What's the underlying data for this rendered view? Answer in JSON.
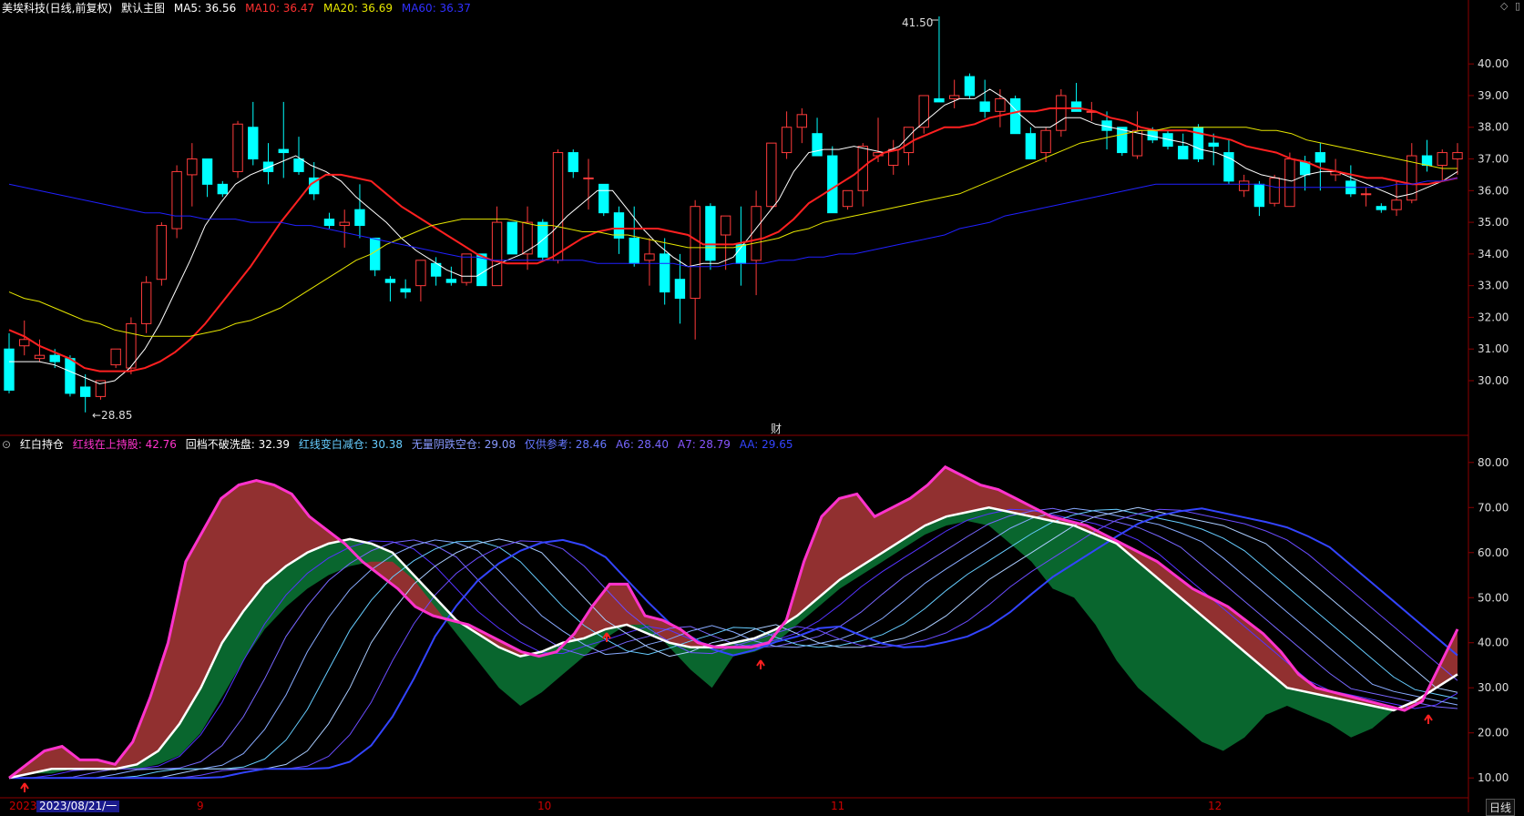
{
  "header": {
    "stock": "美埃科技(日线,前复权)",
    "main_chart": "默认主图",
    "ma5": "MA5: 36.56",
    "ma10": "MA10: 36.47",
    "ma20": "MA20: 36.69",
    "ma60": "MA60: 36.37"
  },
  "indicator_header": {
    "name": "红白持仓",
    "v1": "红线在上持股: 42.76",
    "v2": "回档不破洗盘: 32.39",
    "v3": "红线变白减仓: 30.38",
    "v4": "无量阴跌空仓: 29.08",
    "v5": "仅供参考: 28.46",
    "v6": "A6: 28.40",
    "v7": "A7: 28.79",
    "v8": "AA: 29.65"
  },
  "price_axis": [
    "40.00",
    "39.00",
    "38.00",
    "37.00",
    "36.00",
    "35.00",
    "34.00",
    "33.00",
    "32.00",
    "31.00",
    "30.00"
  ],
  "ind_axis": [
    "80.00",
    "70.00",
    "60.00",
    "50.00",
    "40.00",
    "30.00",
    "20.00",
    "10.00"
  ],
  "annotations": {
    "high": "41.50",
    "low": "←28.85",
    "cai": "财"
  },
  "xaxis": {
    "year": "2023",
    "cursor_date": "2023/08/21/一",
    "months": [
      "9",
      "10",
      "11",
      "12"
    ],
    "period": "日线"
  },
  "colors": {
    "up": "#ff3b3b",
    "down": "#00ffff",
    "ma5": "#ffffff",
    "ma10": "#ff2020",
    "ma20": "#e6e600",
    "ma60": "#2020ff",
    "magenta": "#ff33cc",
    "red_fill": "#993333",
    "green_fill": "#0a6b30"
  },
  "chart_data": {
    "type": "candlestick",
    "ohlc": [
      [
        31.0,
        31.5,
        29.6,
        29.7
      ],
      [
        31.1,
        31.9,
        30.8,
        31.3
      ],
      [
        30.7,
        31.3,
        30.6,
        30.8
      ],
      [
        30.8,
        31.0,
        30.4,
        30.6
      ],
      [
        30.7,
        30.8,
        29.5,
        29.6
      ],
      [
        29.8,
        30.2,
        29.0,
        29.5
      ],
      [
        29.5,
        30.0,
        29.4,
        30.0
      ],
      [
        30.5,
        31.0,
        30.4,
        31.0
      ],
      [
        30.4,
        32.0,
        30.2,
        31.8
      ],
      [
        31.8,
        33.3,
        31.5,
        33.1
      ],
      [
        33.2,
        35.0,
        33.0,
        34.9
      ],
      [
        34.8,
        36.8,
        34.5,
        36.6
      ],
      [
        36.5,
        37.5,
        35.5,
        37.0
      ],
      [
        37.0,
        36.9,
        35.8,
        36.2
      ],
      [
        36.2,
        36.3,
        35.8,
        35.9
      ],
      [
        36.6,
        38.2,
        36.4,
        38.1
      ],
      [
        38.0,
        38.8,
        36.8,
        37.0
      ],
      [
        36.9,
        37.5,
        36.2,
        36.6
      ],
      [
        37.3,
        38.8,
        36.4,
        37.2
      ],
      [
        37.0,
        37.7,
        36.5,
        36.6
      ],
      [
        36.4,
        36.9,
        35.7,
        35.9
      ],
      [
        35.1,
        35.3,
        34.8,
        34.9
      ],
      [
        34.9,
        35.4,
        34.2,
        35.0
      ],
      [
        35.4,
        36.2,
        34.5,
        34.9
      ],
      [
        34.5,
        34.5,
        33.3,
        33.5
      ],
      [
        33.2,
        33.3,
        32.5,
        33.1
      ],
      [
        32.9,
        33.2,
        32.6,
        32.8
      ],
      [
        33.0,
        33.7,
        32.5,
        33.8
      ],
      [
        33.7,
        33.9,
        33.0,
        33.3
      ],
      [
        33.2,
        33.6,
        33.0,
        33.1
      ],
      [
        33.1,
        34.0,
        33.0,
        34.0
      ],
      [
        34.0,
        34.0,
        33.0,
        33.0
      ],
      [
        33.0,
        35.5,
        33.0,
        35.0
      ],
      [
        35.0,
        35.0,
        34.0,
        34.0
      ],
      [
        34.0,
        35.5,
        33.5,
        35.0
      ],
      [
        35.0,
        35.1,
        33.8,
        33.9
      ],
      [
        33.8,
        37.3,
        33.7,
        37.2
      ],
      [
        37.2,
        37.3,
        36.4,
        36.6
      ],
      [
        36.4,
        37.0,
        35.4,
        36.4
      ],
      [
        36.2,
        36.2,
        35.2,
        35.3
      ],
      [
        35.3,
        35.5,
        34.0,
        34.5
      ],
      [
        34.5,
        35.5,
        33.6,
        33.7
      ],
      [
        33.8,
        34.5,
        33.0,
        34.0
      ],
      [
        34.0,
        34.5,
        32.4,
        32.8
      ],
      [
        33.2,
        34.0,
        31.8,
        32.6
      ],
      [
        32.6,
        35.7,
        31.3,
        35.5
      ],
      [
        35.5,
        35.6,
        33.5,
        33.8
      ],
      [
        34.6,
        35.2,
        33.5,
        35.2
      ],
      [
        34.3,
        35.5,
        33.0,
        33.7
      ],
      [
        33.8,
        36.0,
        32.7,
        35.5
      ],
      [
        35.5,
        37.5,
        35.4,
        37.5
      ],
      [
        37.2,
        38.5,
        37.0,
        38.0
      ],
      [
        38.0,
        38.6,
        37.5,
        38.4
      ],
      [
        37.8,
        38.3,
        37.2,
        37.1
      ],
      [
        37.1,
        37.4,
        35.8,
        35.3
      ],
      [
        35.5,
        36.0,
        35.4,
        36.0
      ],
      [
        36.0,
        37.5,
        35.5,
        37.4
      ],
      [
        37.1,
        38.3,
        36.9,
        37.2
      ],
      [
        36.8,
        37.6,
        36.5,
        37.3
      ],
      [
        37.2,
        38.0,
        36.8,
        38.0
      ],
      [
        38.0,
        39.0,
        37.8,
        39.0
      ],
      [
        38.9,
        41.5,
        38.8,
        38.8
      ],
      [
        38.9,
        39.5,
        38.6,
        39.0
      ],
      [
        39.6,
        39.7,
        38.9,
        39.0
      ],
      [
        38.8,
        39.5,
        38.3,
        38.5
      ],
      [
        38.5,
        39.2,
        38.0,
        38.9
      ],
      [
        38.9,
        39.0,
        37.8,
        37.8
      ],
      [
        37.8,
        38.0,
        37.0,
        37.0
      ],
      [
        37.2,
        38.0,
        36.9,
        37.9
      ],
      [
        37.9,
        39.2,
        37.7,
        39.0
      ],
      [
        38.8,
        39.4,
        38.5,
        38.5
      ],
      [
        38.5,
        38.8,
        38.2,
        38.5
      ],
      [
        38.2,
        38.5,
        37.3,
        37.9
      ],
      [
        38.0,
        38.0,
        37.1,
        37.2
      ],
      [
        37.1,
        38.5,
        37.0,
        37.9
      ],
      [
        37.9,
        38.0,
        37.5,
        37.6
      ],
      [
        37.8,
        37.9,
        37.3,
        37.4
      ],
      [
        37.4,
        37.8,
        37.0,
        37.0
      ],
      [
        38.0,
        38.1,
        36.9,
        37.0
      ],
      [
        37.5,
        37.8,
        36.8,
        37.4
      ],
      [
        37.2,
        37.6,
        36.2,
        36.3
      ],
      [
        36.0,
        36.5,
        35.8,
        36.3
      ],
      [
        36.2,
        36.3,
        35.2,
        35.5
      ],
      [
        35.6,
        36.5,
        35.5,
        36.4
      ],
      [
        35.5,
        37.2,
        35.5,
        37.0
      ],
      [
        36.9,
        37.1,
        36.0,
        36.5
      ],
      [
        37.2,
        37.5,
        36.0,
        36.9
      ],
      [
        36.5,
        37.0,
        36.3,
        36.6
      ],
      [
        36.3,
        36.8,
        35.8,
        35.9
      ],
      [
        35.9,
        36.1,
        35.5,
        35.9
      ],
      [
        35.5,
        35.6,
        35.3,
        35.4
      ],
      [
        35.4,
        36.3,
        35.2,
        35.7
      ],
      [
        35.7,
        37.5,
        35.6,
        37.1
      ],
      [
        37.1,
        37.6,
        36.6,
        36.8
      ],
      [
        36.8,
        37.3,
        36.3,
        37.2
      ],
      [
        37.0,
        37.5,
        36.5,
        37.2
      ]
    ],
    "series": [
      {
        "name": "MA5",
        "values": [
          30.6,
          30.6,
          30.6,
          30.5,
          30.3,
          30.1,
          29.9,
          30.0,
          30.4,
          31.0,
          31.8,
          32.8,
          33.8,
          34.9,
          35.6,
          36.2,
          36.5,
          36.7,
          36.9,
          37.1,
          36.8,
          36.6,
          36.3,
          35.8,
          35.4,
          35.0,
          34.5,
          34.1,
          33.8,
          33.5,
          33.3,
          33.3,
          33.6,
          33.8,
          34.0,
          34.3,
          34.7,
          35.2,
          35.6,
          36.0,
          36.0,
          35.4,
          34.8,
          34.3,
          33.9,
          33.6,
          33.7,
          33.7,
          33.9,
          34.5,
          35.1,
          35.7,
          36.6,
          37.2,
          37.3,
          37.3,
          37.4,
          37.3,
          37.2,
          37.4,
          37.9,
          38.3,
          38.7,
          38.9,
          38.9,
          39.2,
          38.9,
          38.4,
          38.0,
          38.0,
          38.3,
          38.3,
          38.1,
          38.0,
          37.9,
          37.8,
          37.7,
          37.6,
          37.5,
          37.3,
          37.2,
          37.0,
          36.7,
          36.5,
          36.4,
          36.3,
          36.5,
          36.6,
          36.6,
          36.4,
          36.2,
          36.0,
          35.8,
          35.9,
          36.1,
          36.3,
          36.6
        ]
      },
      {
        "name": "MA10",
        "values": [
          31.6,
          31.4,
          31.1,
          30.9,
          30.7,
          30.4,
          30.3,
          30.3,
          30.3,
          30.4,
          30.6,
          30.9,
          31.3,
          31.8,
          32.4,
          33.0,
          33.6,
          34.3,
          35.0,
          35.6,
          36.2,
          36.5,
          36.5,
          36.4,
          36.3,
          35.9,
          35.5,
          35.2,
          34.9,
          34.6,
          34.3,
          34.0,
          33.8,
          33.7,
          33.7,
          33.7,
          33.9,
          34.2,
          34.5,
          34.7,
          34.8,
          34.8,
          34.8,
          34.8,
          34.7,
          34.6,
          34.3,
          34.3,
          34.3,
          34.4,
          34.5,
          34.7,
          35.1,
          35.6,
          35.9,
          36.2,
          36.5,
          36.9,
          37.2,
          37.3,
          37.6,
          37.8,
          38.0,
          38.0,
          38.1,
          38.3,
          38.4,
          38.5,
          38.5,
          38.6,
          38.6,
          38.6,
          38.5,
          38.3,
          38.2,
          38.0,
          37.9,
          37.9,
          37.9,
          37.8,
          37.7,
          37.6,
          37.4,
          37.3,
          37.2,
          37.0,
          36.9,
          36.7,
          36.6,
          36.5,
          36.4,
          36.4,
          36.3,
          36.2,
          36.2,
          36.3,
          36.4
        ]
      },
      {
        "name": "MA20",
        "values": [
          32.8,
          32.6,
          32.5,
          32.3,
          32.1,
          31.9,
          31.8,
          31.6,
          31.5,
          31.4,
          31.4,
          31.4,
          31.4,
          31.5,
          31.6,
          31.8,
          31.9,
          32.1,
          32.3,
          32.6,
          32.9,
          33.2,
          33.5,
          33.8,
          34.0,
          34.3,
          34.5,
          34.7,
          34.9,
          35.0,
          35.1,
          35.1,
          35.1,
          35.1,
          35.0,
          34.9,
          34.9,
          34.8,
          34.7,
          34.7,
          34.6,
          34.6,
          34.5,
          34.4,
          34.3,
          34.2,
          34.2,
          34.2,
          34.2,
          34.3,
          34.4,
          34.5,
          34.7,
          34.8,
          35.0,
          35.1,
          35.2,
          35.3,
          35.4,
          35.5,
          35.6,
          35.7,
          35.8,
          35.9,
          36.1,
          36.3,
          36.5,
          36.7,
          36.9,
          37.1,
          37.3,
          37.5,
          37.6,
          37.7,
          37.8,
          37.9,
          37.9,
          38.0,
          38.0,
          38.0,
          38.0,
          38.0,
          38.0,
          37.9,
          37.9,
          37.8,
          37.6,
          37.5,
          37.4,
          37.3,
          37.2,
          37.1,
          37.0,
          36.9,
          36.8,
          36.7,
          36.7
        ]
      },
      {
        "name": "MA60",
        "values": [
          36.2,
          36.1,
          36.0,
          35.9,
          35.8,
          35.7,
          35.6,
          35.5,
          35.4,
          35.3,
          35.3,
          35.2,
          35.2,
          35.1,
          35.1,
          35.1,
          35.0,
          35.0,
          35.0,
          34.9,
          34.9,
          34.8,
          34.7,
          34.6,
          34.5,
          34.4,
          34.3,
          34.2,
          34.1,
          34.0,
          33.9,
          33.9,
          33.8,
          33.8,
          33.8,
          33.8,
          33.8,
          33.8,
          33.8,
          33.7,
          33.7,
          33.7,
          33.7,
          33.7,
          33.7,
          33.6,
          33.6,
          33.6,
          33.7,
          33.7,
          33.7,
          33.8,
          33.8,
          33.9,
          33.9,
          34.0,
          34.0,
          34.1,
          34.2,
          34.3,
          34.4,
          34.5,
          34.6,
          34.8,
          34.9,
          35.0,
          35.2,
          35.3,
          35.4,
          35.5,
          35.6,
          35.7,
          35.8,
          35.9,
          36.0,
          36.1,
          36.2,
          36.2,
          36.2,
          36.2,
          36.2,
          36.2,
          36.2,
          36.2,
          36.1,
          36.1,
          36.1,
          36.1,
          36.1,
          36.1,
          36.1,
          36.1,
          36.2,
          36.2,
          36.3,
          36.3,
          36.4
        ]
      }
    ],
    "indicator": {
      "magenta": [
        10,
        13,
        16,
        17,
        14,
        14,
        13,
        18,
        28,
        40,
        58,
        65,
        72,
        75,
        76,
        75,
        73,
        68,
        65,
        62,
        58,
        55,
        52,
        48,
        46,
        45,
        44,
        42,
        40,
        38,
        37,
        38,
        42,
        48,
        53,
        53,
        46,
        45,
        43,
        40,
        39,
        39,
        39,
        40,
        45,
        58,
        68,
        72,
        73,
        68,
        70,
        72,
        75,
        79,
        77,
        75,
        74,
        72,
        70,
        68,
        67,
        66,
        64,
        62,
        60,
        58,
        55,
        52,
        50,
        48,
        45,
        42,
        38,
        33,
        30,
        29,
        28,
        27,
        26,
        25,
        27,
        35,
        43
      ],
      "white": [
        10,
        11,
        12,
        12,
        12,
        12,
        13,
        16,
        22,
        30,
        40,
        47,
        53,
        57,
        60,
        62,
        63,
        62,
        60,
        55,
        50,
        45,
        42,
        39,
        37,
        38,
        40,
        41,
        43,
        44,
        42,
        40,
        39,
        39,
        40,
        41,
        43,
        46,
        50,
        54,
        57,
        60,
        63,
        66,
        68,
        69,
        70,
        69,
        68,
        67,
        66,
        64,
        62,
        58,
        54,
        50,
        46,
        42,
        38,
        34,
        30,
        29,
        28,
        27,
        26,
        25,
        27,
        30,
        33
      ],
      "lower": [
        10,
        11,
        11,
        12,
        12,
        12,
        12,
        13,
        15,
        20,
        28,
        36,
        43,
        48,
        52,
        55,
        57,
        58,
        58,
        54,
        48,
        42,
        36,
        30,
        26,
        29,
        33,
        37,
        41,
        44,
        44,
        39,
        34,
        30,
        37,
        38,
        40,
        44,
        48,
        52,
        55,
        58,
        61,
        64,
        66,
        67,
        66,
        62,
        58,
        52,
        50,
        44,
        36,
        30,
        26,
        22,
        18,
        16,
        19,
        24,
        26,
        24,
        22,
        19,
        21,
        25,
        27,
        30,
        33
      ]
    }
  }
}
